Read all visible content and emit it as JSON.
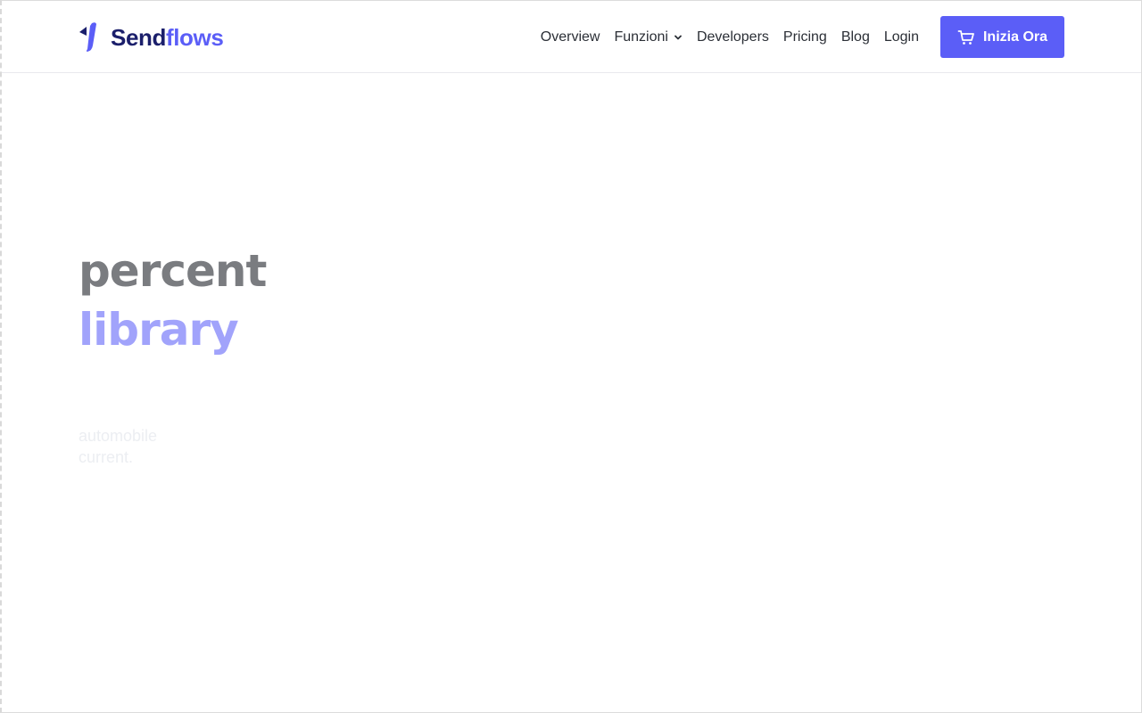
{
  "brand": {
    "name_part1": "Send",
    "name_part2": "flows",
    "colors": {
      "dark": "#1b1f6b",
      "accent": "#5b5ef7"
    }
  },
  "nav": {
    "items": [
      {
        "label": "Overview",
        "has_dropdown": false
      },
      {
        "label": "Funzioni",
        "has_dropdown": true
      },
      {
        "label": "Developers",
        "has_dropdown": false
      },
      {
        "label": "Pricing",
        "has_dropdown": false
      },
      {
        "label": "Blog",
        "has_dropdown": false
      },
      {
        "label": "Login",
        "has_dropdown": false
      }
    ],
    "cta": {
      "label": "Inizia Ora",
      "icon": "shopping-cart-icon",
      "color": "#5b5ef7"
    }
  },
  "hero": {
    "title_line1": "percent",
    "title_line2": "library",
    "subtitle_line1": "automobile",
    "subtitle_line2": "current."
  }
}
